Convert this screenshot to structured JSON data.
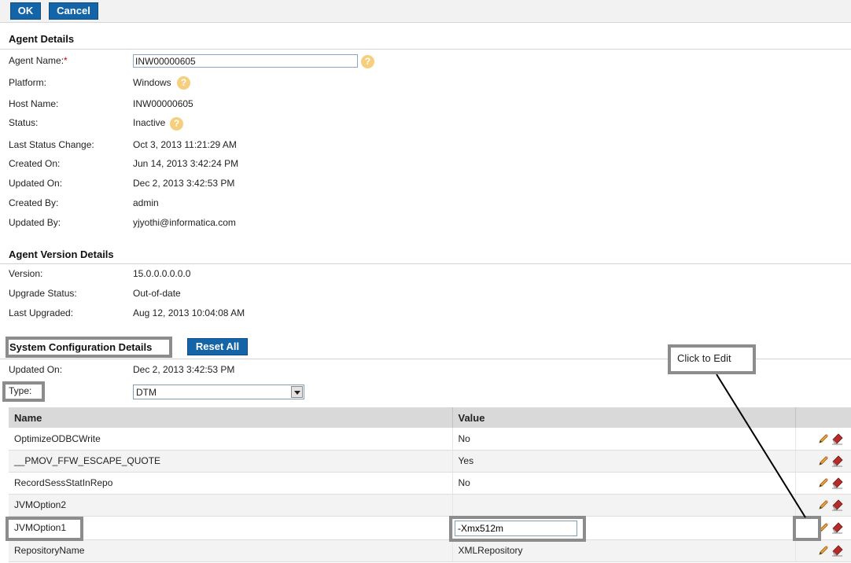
{
  "toolbar": {
    "ok_label": "OK",
    "cancel_label": "Cancel"
  },
  "agent_details": {
    "title": "Agent Details",
    "fields": [
      {
        "label": "Agent Name:",
        "value": "INW00000605"
      },
      {
        "label": "Platform:",
        "value": "Windows"
      },
      {
        "label": "Host Name:",
        "value": "INW00000605"
      },
      {
        "label": "Status:",
        "value": "Inactive"
      },
      {
        "label": "Last Status Change:",
        "value": "Oct 3, 2013 11:21:29 AM"
      },
      {
        "label": "Created On:",
        "value": "Jun 14, 2013 3:42:24 PM"
      },
      {
        "label": "Updated On:",
        "value": "Dec 2, 2013 3:42:53 PM"
      },
      {
        "label": "Created By:",
        "value": "admin"
      },
      {
        "label": "Updated By:",
        "value": "yjyothi@informatica.com"
      }
    ],
    "required_marker": "*"
  },
  "agent_version": {
    "title": "Agent Version Details",
    "fields": [
      {
        "label": "Version:",
        "value": "15.0.0.0.0.0.0"
      },
      {
        "label": "Upgrade Status:",
        "value": "Out-of-date"
      },
      {
        "label": "Last Upgraded:",
        "value": "Aug 12, 2013 10:04:08 AM"
      }
    ]
  },
  "system_config": {
    "title": "System Configuration Details",
    "reset_label": "Reset All",
    "updated_label": "Updated On:",
    "updated_value": "Dec 2, 2013 3:42:53 PM",
    "type_label": "Type:",
    "type_value": "DTM",
    "columns": [
      "Name",
      "Value",
      ""
    ],
    "rows": [
      {
        "name": "OptimizeODBCWrite",
        "value": "No"
      },
      {
        "name": "__PMOV_FFW_ESCAPE_QUOTE",
        "value": "Yes"
      },
      {
        "name": "RecordSessStatInRepo",
        "value": "No"
      },
      {
        "name": "JVMOption2",
        "value": ""
      },
      {
        "name": "JVMOption1",
        "value": "-Xmx512m"
      },
      {
        "name": "RepositoryName",
        "value": "XMLRepository"
      }
    ]
  },
  "annotation": {
    "callout_text": "Click to Edit"
  },
  "icons": {
    "help": "help-icon",
    "edit": "pencil-icon",
    "reset": "eraser-icon"
  },
  "colors": {
    "primary_button": "#1464a8",
    "help_icon": "#f6cf7e",
    "required": "#d00000",
    "callout_border": "#8c8c8c"
  }
}
